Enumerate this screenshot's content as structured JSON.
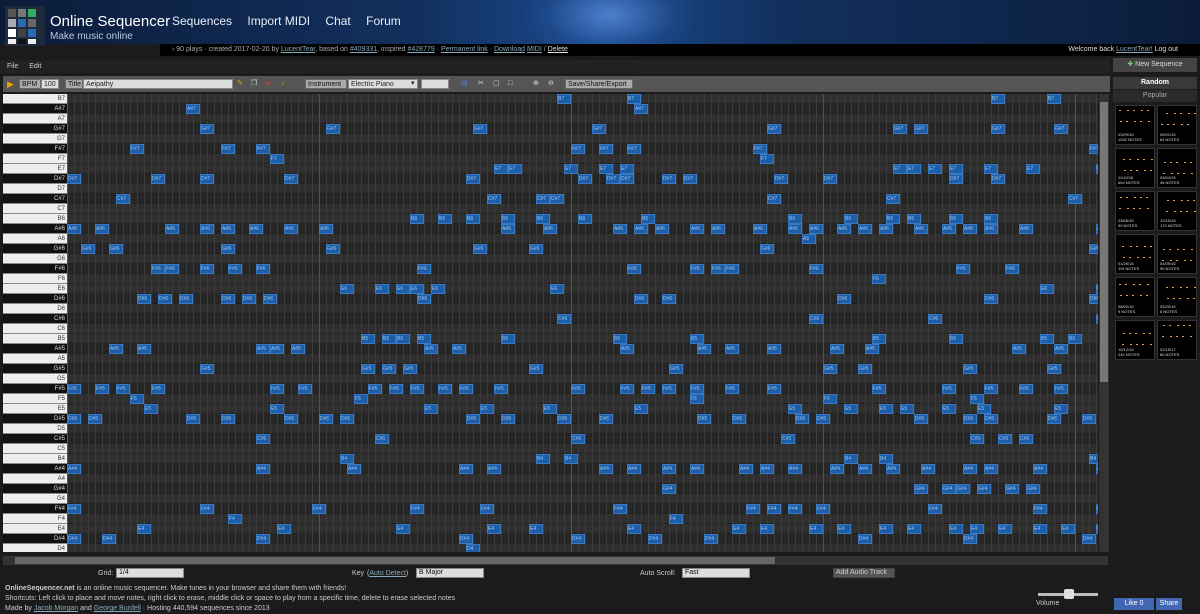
{
  "header": {
    "title": "Online Sequencer",
    "subtitle": "Make music online",
    "nav": [
      "Sequences",
      "Import MIDI",
      "Chat",
      "Forum"
    ]
  },
  "infobar": {
    "plays": "› 90 plays · created 2017-02-20 by",
    "author": "LucentTear",
    "based_text": ", based on",
    "based_id": "#409331",
    "inspired_text": ", inspired",
    "inspired_id": "#428779",
    "permalink": "Permanent link",
    "download": "Download",
    "midi": "MIDI",
    "delete": "Delete",
    "welcome": "Welcome back",
    "user": "LucentTear!",
    "logout": "Log out"
  },
  "menu": [
    "File",
    "Edit"
  ],
  "toolbar": {
    "bpm_label": "BPM",
    "bpm_value": "100",
    "title_label": "Title",
    "title_value": "Aeipathy",
    "instrument_label": "Instrument",
    "instrument_value": "Electric Piano",
    "save_label": "Save/Share/Export"
  },
  "keys": [
    "B7",
    "A#7",
    "A7",
    "G#7",
    "G7",
    "F#7",
    "F7",
    "E7",
    "D#7",
    "D7",
    "C#7",
    "C7",
    "B6",
    "A#6",
    "A6",
    "G#6",
    "G6",
    "F#6",
    "F6",
    "E6",
    "D#6",
    "D6",
    "C#6",
    "C6",
    "B5",
    "A#5",
    "A5",
    "G#5",
    "G5",
    "F#5",
    "F5",
    "E5",
    "D#5",
    "D5",
    "C#5",
    "C5",
    "B4",
    "A#4",
    "A4",
    "G#4",
    "G4",
    "F#4",
    "F4",
    "E4",
    "D#4",
    "D4"
  ],
  "bottom": {
    "grid_label": "Grid:",
    "grid_value": "1/4",
    "key_label": "Key",
    "key_link": "Auto Detect",
    "key_value": "B Major",
    "autoscroll_label": "Auto Scroll:",
    "autoscroll_value": "Fast",
    "add_audio": "Add Audio Track"
  },
  "footer": {
    "line1_site": "OnlineSequencer.net",
    "line1": " is an online music sequencer. Make tunes in your browser and share them with friends!",
    "line2": "Shortcuts: Left click to place and move notes, right click to erase, middle click or space to play from a specific time, delete to erase selected notes",
    "line3_pre": "Made by",
    "author1": "Jacob Morgan",
    "and": "and",
    "author2": "George Burdell",
    "hosting": " · Hosting 440,594 sequences since 2013"
  },
  "sidebar": {
    "new_sequence": "New Sequence",
    "random": "Random",
    "popular": "Popular",
    "thumbs": [
      {
        "date": "03/29/16",
        "notes": "1042 NOTES"
      },
      {
        "date": "05/31/15",
        "notes": "64 NOTES"
      },
      {
        "date": "11/19/16",
        "notes": "664 NOTES"
      },
      {
        "date": "03/04/15",
        "notes": "46 NOTES"
      },
      {
        "date": "03/06/16",
        "notes": "90 NOTES"
      },
      {
        "date": "12/10/15",
        "notes": "179 NOTES"
      },
      {
        "date": "01/26/16",
        "notes": "119 NOTES"
      },
      {
        "date": "01/09/16",
        "notes": "90 NOTES"
      },
      {
        "date": "08/02/16",
        "notes": "9 NOTES"
      },
      {
        "date": "03/20/16",
        "notes": "8 NOTES"
      },
      {
        "date": "10/12/16",
        "notes": "240 NOTES"
      },
      {
        "date": "02/15/17",
        "notes": "80 NOTES"
      }
    ],
    "like": "Like 0",
    "share": "Share"
  },
  "volume_label": "Volume",
  "notes": [
    {
      "r": 0,
      "c": 70
    },
    {
      "r": 0,
      "c": 80
    },
    {
      "r": 0,
      "c": 132
    },
    {
      "r": 0,
      "c": 140
    },
    {
      "r": 1,
      "c": 17
    },
    {
      "r": 1,
      "c": 81
    },
    {
      "r": 3,
      "c": 19
    },
    {
      "r": 3,
      "c": 37
    },
    {
      "r": 3,
      "c": 58
    },
    {
      "r": 3,
      "c": 75
    },
    {
      "r": 3,
      "c": 100
    },
    {
      "r": 3,
      "c": 118
    },
    {
      "r": 3,
      "c": 121
    },
    {
      "r": 3,
      "c": 132
    },
    {
      "r": 3,
      "c": 141
    },
    {
      "r": 3,
      "c": 148
    },
    {
      "r": 5,
      "c": 9
    },
    {
      "r": 5,
      "c": 22
    },
    {
      "r": 5,
      "c": 27
    },
    {
      "r": 5,
      "c": 72
    },
    {
      "r": 5,
      "c": 76
    },
    {
      "r": 5,
      "c": 80
    },
    {
      "r": 5,
      "c": 98
    },
    {
      "r": 5,
      "c": 146
    },
    {
      "r": 6,
      "c": 29
    },
    {
      "r": 6,
      "c": 99
    },
    {
      "r": 7,
      "c": 61
    },
    {
      "r": 7,
      "c": 63
    },
    {
      "r": 7,
      "c": 71
    },
    {
      "r": 7,
      "c": 76
    },
    {
      "r": 7,
      "c": 79
    },
    {
      "r": 7,
      "c": 118
    },
    {
      "r": 7,
      "c": 120
    },
    {
      "r": 7,
      "c": 123
    },
    {
      "r": 7,
      "c": 126
    },
    {
      "r": 7,
      "c": 131
    },
    {
      "r": 7,
      "c": 137
    },
    {
      "r": 7,
      "c": 147
    },
    {
      "r": 8,
      "c": 0
    },
    {
      "r": 8,
      "c": 12
    },
    {
      "r": 8,
      "c": 19
    },
    {
      "r": 8,
      "c": 31
    },
    {
      "r": 8,
      "c": 57
    },
    {
      "r": 8,
      "c": 73
    },
    {
      "r": 8,
      "c": 77
    },
    {
      "r": 8,
      "c": 79
    },
    {
      "r": 8,
      "c": 85
    },
    {
      "r": 8,
      "c": 88
    },
    {
      "r": 8,
      "c": 101
    },
    {
      "r": 8,
      "c": 108
    },
    {
      "r": 8,
      "c": 126
    },
    {
      "r": 8,
      "c": 132
    },
    {
      "r": 8,
      "c": 148
    },
    {
      "r": 10,
      "c": 7
    },
    {
      "r": 10,
      "c": 60
    },
    {
      "r": 10,
      "c": 67
    },
    {
      "r": 10,
      "c": 69
    },
    {
      "r": 10,
      "c": 100
    },
    {
      "r": 10,
      "c": 117
    },
    {
      "r": 10,
      "c": 143
    },
    {
      "r": 10,
      "c": 148
    },
    {
      "r": 12,
      "c": 49
    },
    {
      "r": 12,
      "c": 53
    },
    {
      "r": 12,
      "c": 57
    },
    {
      "r": 12,
      "c": 62
    },
    {
      "r": 12,
      "c": 67
    },
    {
      "r": 12,
      "c": 73
    },
    {
      "r": 12,
      "c": 82
    },
    {
      "r": 12,
      "c": 103
    },
    {
      "r": 12,
      "c": 111
    },
    {
      "r": 12,
      "c": 117
    },
    {
      "r": 12,
      "c": 120
    },
    {
      "r": 12,
      "c": 126
    },
    {
      "r": 12,
      "c": 131
    },
    {
      "r": 13,
      "c": 0
    },
    {
      "r": 13,
      "c": 4
    },
    {
      "r": 13,
      "c": 14
    },
    {
      "r": 13,
      "c": 19
    },
    {
      "r": 13,
      "c": 22
    },
    {
      "r": 13,
      "c": 26
    },
    {
      "r": 13,
      "c": 31
    },
    {
      "r": 13,
      "c": 36
    },
    {
      "r": 13,
      "c": 62
    },
    {
      "r": 13,
      "c": 68
    },
    {
      "r": 13,
      "c": 78
    },
    {
      "r": 13,
      "c": 81
    },
    {
      "r": 13,
      "c": 84
    },
    {
      "r": 13,
      "c": 89
    },
    {
      "r": 13,
      "c": 92
    },
    {
      "r": 13,
      "c": 98
    },
    {
      "r": 13,
      "c": 103
    },
    {
      "r": 13,
      "c": 106
    },
    {
      "r": 13,
      "c": 110
    },
    {
      "r": 13,
      "c": 113
    },
    {
      "r": 13,
      "c": 116
    },
    {
      "r": 13,
      "c": 121
    },
    {
      "r": 13,
      "c": 125
    },
    {
      "r": 13,
      "c": 128
    },
    {
      "r": 13,
      "c": 131
    },
    {
      "r": 13,
      "c": 136
    },
    {
      "r": 13,
      "c": 147
    },
    {
      "r": 14,
      "c": 105
    },
    {
      "r": 14,
      "c": 148
    },
    {
      "r": 15,
      "c": 2
    },
    {
      "r": 15,
      "c": 6
    },
    {
      "r": 15,
      "c": 22
    },
    {
      "r": 15,
      "c": 37
    },
    {
      "r": 15,
      "c": 58
    },
    {
      "r": 15,
      "c": 66
    },
    {
      "r": 15,
      "c": 99
    },
    {
      "r": 15,
      "c": 146
    },
    {
      "r": 17,
      "c": 12
    },
    {
      "r": 17,
      "c": 14
    },
    {
      "r": 17,
      "c": 19
    },
    {
      "r": 17,
      "c": 23
    },
    {
      "r": 17,
      "c": 27
    },
    {
      "r": 17,
      "c": 50
    },
    {
      "r": 17,
      "c": 80
    },
    {
      "r": 17,
      "c": 89
    },
    {
      "r": 17,
      "c": 92
    },
    {
      "r": 17,
      "c": 94
    },
    {
      "r": 17,
      "c": 106
    },
    {
      "r": 17,
      "c": 127
    },
    {
      "r": 17,
      "c": 134
    },
    {
      "r": 18,
      "c": 115
    },
    {
      "r": 19,
      "c": 39
    },
    {
      "r": 19,
      "c": 44
    },
    {
      "r": 19,
      "c": 47
    },
    {
      "r": 19,
      "c": 49
    },
    {
      "r": 19,
      "c": 52
    },
    {
      "r": 19,
      "c": 69
    },
    {
      "r": 19,
      "c": 139
    },
    {
      "r": 19,
      "c": 147
    },
    {
      "r": 20,
      "c": 10
    },
    {
      "r": 20,
      "c": 13
    },
    {
      "r": 20,
      "c": 16
    },
    {
      "r": 20,
      "c": 22
    },
    {
      "r": 20,
      "c": 25
    },
    {
      "r": 20,
      "c": 28
    },
    {
      "r": 20,
      "c": 50
    },
    {
      "r": 20,
      "c": 81
    },
    {
      "r": 20,
      "c": 85
    },
    {
      "r": 20,
      "c": 110
    },
    {
      "r": 20,
      "c": 131
    },
    {
      "r": 20,
      "c": 146
    },
    {
      "r": 22,
      "c": 70
    },
    {
      "r": 22,
      "c": 106
    },
    {
      "r": 22,
      "c": 123
    },
    {
      "r": 22,
      "c": 147
    },
    {
      "r": 24,
      "c": 42
    },
    {
      "r": 24,
      "c": 45
    },
    {
      "r": 24,
      "c": 47
    },
    {
      "r": 24,
      "c": 50
    },
    {
      "r": 24,
      "c": 62
    },
    {
      "r": 24,
      "c": 78
    },
    {
      "r": 24,
      "c": 89
    },
    {
      "r": 24,
      "c": 115
    },
    {
      "r": 24,
      "c": 126
    },
    {
      "r": 24,
      "c": 139
    },
    {
      "r": 24,
      "c": 143
    },
    {
      "r": 25,
      "c": 6
    },
    {
      "r": 25,
      "c": 10
    },
    {
      "r": 25,
      "c": 27
    },
    {
      "r": 25,
      "c": 29
    },
    {
      "r": 25,
      "c": 32
    },
    {
      "r": 25,
      "c": 51
    },
    {
      "r": 25,
      "c": 55
    },
    {
      "r": 25,
      "c": 79
    },
    {
      "r": 25,
      "c": 90
    },
    {
      "r": 25,
      "c": 94
    },
    {
      "r": 25,
      "c": 100
    },
    {
      "r": 25,
      "c": 109
    },
    {
      "r": 25,
      "c": 114
    },
    {
      "r": 25,
      "c": 135
    },
    {
      "r": 25,
      "c": 141
    },
    {
      "r": 25,
      "c": 148
    },
    {
      "r": 27,
      "c": 19
    },
    {
      "r": 27,
      "c": 42
    },
    {
      "r": 27,
      "c": 45
    },
    {
      "r": 27,
      "c": 48
    },
    {
      "r": 27,
      "c": 66
    },
    {
      "r": 27,
      "c": 86
    },
    {
      "r": 27,
      "c": 108
    },
    {
      "r": 27,
      "c": 113
    },
    {
      "r": 27,
      "c": 128
    },
    {
      "r": 27,
      "c": 140
    },
    {
      "r": 27,
      "c": 148
    },
    {
      "r": 29,
      "c": 0
    },
    {
      "r": 29,
      "c": 4
    },
    {
      "r": 29,
      "c": 7
    },
    {
      "r": 29,
      "c": 12
    },
    {
      "r": 29,
      "c": 29
    },
    {
      "r": 29,
      "c": 33
    },
    {
      "r": 29,
      "c": 43
    },
    {
      "r": 29,
      "c": 46
    },
    {
      "r": 29,
      "c": 49
    },
    {
      "r": 29,
      "c": 53
    },
    {
      "r": 29,
      "c": 56
    },
    {
      "r": 29,
      "c": 61
    },
    {
      "r": 29,
      "c": 72
    },
    {
      "r": 29,
      "c": 79
    },
    {
      "r": 29,
      "c": 82
    },
    {
      "r": 29,
      "c": 85
    },
    {
      "r": 29,
      "c": 89
    },
    {
      "r": 29,
      "c": 94
    },
    {
      "r": 29,
      "c": 100
    },
    {
      "r": 29,
      "c": 115
    },
    {
      "r": 29,
      "c": 125
    },
    {
      "r": 29,
      "c": 131
    },
    {
      "r": 29,
      "c": 136
    },
    {
      "r": 29,
      "c": 141
    },
    {
      "r": 29,
      "c": 148
    },
    {
      "r": 30,
      "c": 9
    },
    {
      "r": 30,
      "c": 41
    },
    {
      "r": 30,
      "c": 89
    },
    {
      "r": 30,
      "c": 108
    },
    {
      "r": 30,
      "c": 129
    },
    {
      "r": 31,
      "c": 11
    },
    {
      "r": 31,
      "c": 29
    },
    {
      "r": 31,
      "c": 51
    },
    {
      "r": 31,
      "c": 59
    },
    {
      "r": 31,
      "c": 68
    },
    {
      "r": 31,
      "c": 81
    },
    {
      "r": 31,
      "c": 103
    },
    {
      "r": 31,
      "c": 111
    },
    {
      "r": 31,
      "c": 116
    },
    {
      "r": 31,
      "c": 119
    },
    {
      "r": 31,
      "c": 125
    },
    {
      "r": 31,
      "c": 130
    },
    {
      "r": 31,
      "c": 141
    },
    {
      "r": 32,
      "c": 0
    },
    {
      "r": 32,
      "c": 3
    },
    {
      "r": 32,
      "c": 17
    },
    {
      "r": 32,
      "c": 22
    },
    {
      "r": 32,
      "c": 31
    },
    {
      "r": 32,
      "c": 36
    },
    {
      "r": 32,
      "c": 39
    },
    {
      "r": 32,
      "c": 57
    },
    {
      "r": 32,
      "c": 62
    },
    {
      "r": 32,
      "c": 70
    },
    {
      "r": 32,
      "c": 76
    },
    {
      "r": 32,
      "c": 90
    },
    {
      "r": 32,
      "c": 95
    },
    {
      "r": 32,
      "c": 104
    },
    {
      "r": 32,
      "c": 107
    },
    {
      "r": 32,
      "c": 121
    },
    {
      "r": 32,
      "c": 128
    },
    {
      "r": 32,
      "c": 131
    },
    {
      "r": 32,
      "c": 140
    },
    {
      "r": 32,
      "c": 145
    },
    {
      "r": 32,
      "c": 148
    },
    {
      "r": 34,
      "c": 27
    },
    {
      "r": 34,
      "c": 44
    },
    {
      "r": 34,
      "c": 72
    },
    {
      "r": 34,
      "c": 102
    },
    {
      "r": 34,
      "c": 129
    },
    {
      "r": 34,
      "c": 133
    },
    {
      "r": 34,
      "c": 136
    },
    {
      "r": 34,
      "c": 148
    },
    {
      "r": 36,
      "c": 39
    },
    {
      "r": 36,
      "c": 67
    },
    {
      "r": 36,
      "c": 71
    },
    {
      "r": 36,
      "c": 111
    },
    {
      "r": 36,
      "c": 116
    },
    {
      "r": 36,
      "c": 146
    },
    {
      "r": 37,
      "c": 0
    },
    {
      "r": 37,
      "c": 27
    },
    {
      "r": 37,
      "c": 40
    },
    {
      "r": 37,
      "c": 56
    },
    {
      "r": 37,
      "c": 60
    },
    {
      "r": 37,
      "c": 76
    },
    {
      "r": 37,
      "c": 80
    },
    {
      "r": 37,
      "c": 85
    },
    {
      "r": 37,
      "c": 89
    },
    {
      "r": 37,
      "c": 96
    },
    {
      "r": 37,
      "c": 99
    },
    {
      "r": 37,
      "c": 103
    },
    {
      "r": 37,
      "c": 109
    },
    {
      "r": 37,
      "c": 113
    },
    {
      "r": 37,
      "c": 117
    },
    {
      "r": 37,
      "c": 122
    },
    {
      "r": 37,
      "c": 128
    },
    {
      "r": 37,
      "c": 131
    },
    {
      "r": 37,
      "c": 138
    },
    {
      "r": 37,
      "c": 147
    },
    {
      "r": 39,
      "c": 85
    },
    {
      "r": 39,
      "c": 121
    },
    {
      "r": 39,
      "c": 125
    },
    {
      "r": 39,
      "c": 127
    },
    {
      "r": 39,
      "c": 130
    },
    {
      "r": 39,
      "c": 134
    },
    {
      "r": 39,
      "c": 137
    },
    {
      "r": 39,
      "c": 148
    },
    {
      "r": 41,
      "c": 0
    },
    {
      "r": 41,
      "c": 19
    },
    {
      "r": 41,
      "c": 35
    },
    {
      "r": 41,
      "c": 49
    },
    {
      "r": 41,
      "c": 59
    },
    {
      "r": 41,
      "c": 78
    },
    {
      "r": 41,
      "c": 97
    },
    {
      "r": 41,
      "c": 100
    },
    {
      "r": 41,
      "c": 103
    },
    {
      "r": 41,
      "c": 107
    },
    {
      "r": 41,
      "c": 123
    },
    {
      "r": 41,
      "c": 138
    },
    {
      "r": 41,
      "c": 147
    },
    {
      "r": 42,
      "c": 23
    },
    {
      "r": 42,
      "c": 86
    },
    {
      "r": 43,
      "c": 10
    },
    {
      "r": 43,
      "c": 30
    },
    {
      "r": 43,
      "c": 47
    },
    {
      "r": 43,
      "c": 60
    },
    {
      "r": 43,
      "c": 66
    },
    {
      "r": 43,
      "c": 80
    },
    {
      "r": 43,
      "c": 95
    },
    {
      "r": 43,
      "c": 99
    },
    {
      "r": 43,
      "c": 106
    },
    {
      "r": 43,
      "c": 110
    },
    {
      "r": 43,
      "c": 116
    },
    {
      "r": 43,
      "c": 120
    },
    {
      "r": 43,
      "c": 126
    },
    {
      "r": 43,
      "c": 129
    },
    {
      "r": 43,
      "c": 133
    },
    {
      "r": 43,
      "c": 138
    },
    {
      "r": 43,
      "c": 142
    },
    {
      "r": 43,
      "c": 147
    },
    {
      "r": 44,
      "c": 0
    },
    {
      "r": 44,
      "c": 5
    },
    {
      "r": 44,
      "c": 27
    },
    {
      "r": 44,
      "c": 56
    },
    {
      "r": 44,
      "c": 72
    },
    {
      "r": 44,
      "c": 83
    },
    {
      "r": 44,
      "c": 91
    },
    {
      "r": 44,
      "c": 113
    },
    {
      "r": 44,
      "c": 128
    },
    {
      "r": 44,
      "c": 145
    },
    {
      "r": 45,
      "c": 57
    }
  ]
}
